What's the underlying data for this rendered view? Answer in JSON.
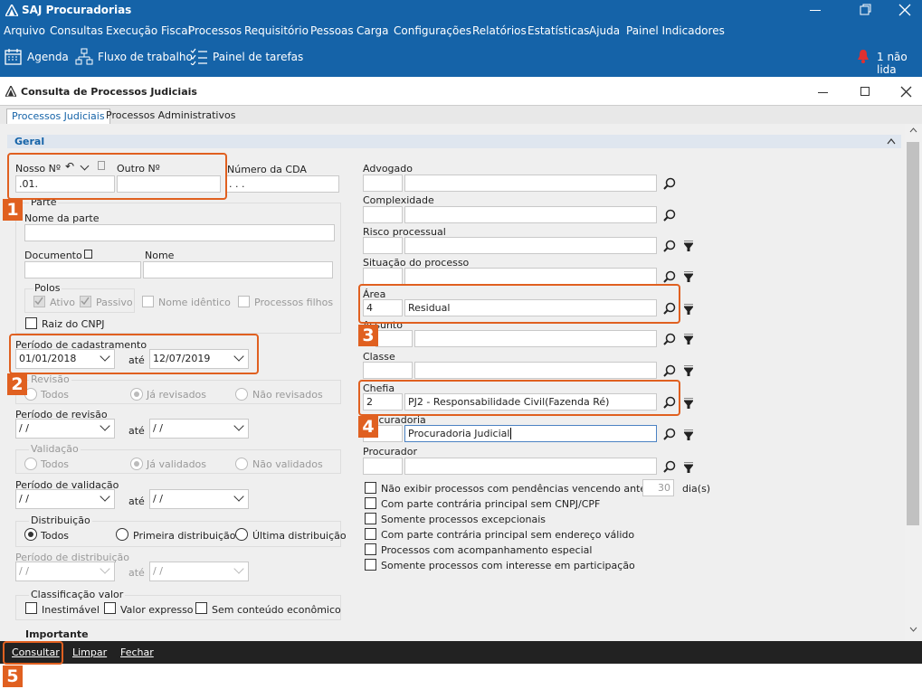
{
  "app": {
    "title": "SAJ Procuradorias"
  },
  "menu": [
    "Arquivo",
    "Consultas",
    "Execução Fiscal",
    "Processos",
    "Requisitório",
    "Pessoas",
    "Carga",
    "Configurações",
    "Relatórios",
    "Estatísticas",
    "Ajuda",
    "Painel Indicadores"
  ],
  "toolbar": {
    "agenda": "Agenda",
    "fluxo": "Fluxo de trabalho",
    "painel": "Painel de tarefas",
    "notif": "1 não lida"
  },
  "window": {
    "title": "Consulta de Processos Judiciais"
  },
  "tabs": [
    "Processos Judiciais",
    "Processos Administrativos"
  ],
  "section": {
    "title": "Geral"
  },
  "form": {
    "nosso_label": "Nosso Nº",
    "nosso_value": ".01.",
    "outro_label": "Outro Nº",
    "cda_label": "Número da CDA",
    "cda_value": ". . .",
    "parte_legend": "Parte",
    "nome_parte_label": "Nome da parte",
    "documento_label": "Documento",
    "nome_label": "Nome",
    "polos_legend": "Polos",
    "ativo": "Ativo",
    "passivo": "Passivo",
    "nome_identico": "Nome idêntico",
    "processos_filhos": "Processos filhos",
    "raiz_cnpj": "Raiz do CNPJ",
    "periodo_cad_label": "Período de cadastramento",
    "periodo_cad_ini": "01/01/2018",
    "ate": "até",
    "periodo_cad_fim": "12/07/2019",
    "revisao_legend": "Revisão",
    "todos": "Todos",
    "ja_revisados": "Já revisados",
    "nao_revisados": "Não revisados",
    "periodo_rev_label": "Período de revisão",
    "date_empty": "/ /",
    "validacao_legend": "Validação",
    "ja_validados": "Já validados",
    "nao_validados": "Não validados",
    "periodo_val_label": "Período de validação",
    "distribuicao_legend": "Distribuição",
    "primeira_dist": "Primeira distribuição",
    "ultima_dist": "Última distribuição",
    "periodo_dist_label": "Período de distribuição",
    "classificacao_legend": "Classificação valor",
    "inestimavel": "Inestimável",
    "valor_expresso": "Valor expresso",
    "sem_conteudo": "Sem conteúdo econômico",
    "importante_legend": "Importante",
    "advogado_label": "Advogado",
    "complexidade_label": "Complexidade",
    "risco_label": "Risco processual",
    "situacao_label": "Situação do processo",
    "area_label": "Área",
    "area_code": "4",
    "area_value": "Residual",
    "assunto_label": "Assunto",
    "classe_label": "Classe",
    "chefia_label": "Chefia",
    "chefia_code": "2",
    "chefia_value": "PJ2 - Responsabilidade Civil(Fazenda Ré)",
    "procuradoria_label": "Procuradoria",
    "procuradoria_value": "Procuradoria Judicial",
    "procurador_label": "Procurador",
    "opt_pendencias": "Não exibir processos com pendências vencendo antes de",
    "opt_pendencias_days": "30",
    "opt_dias": "dia(s)",
    "opt_cnpj": "Com parte contrária principal sem CNPJ/CPF",
    "opt_excepcionais": "Somente processos excepcionais",
    "opt_endereco": "Com parte contrária principal sem endereço válido",
    "opt_acompanhamento": "Processos com acompanhamento especial",
    "opt_interesse": "Somente processos com interesse em participação"
  },
  "buttons": {
    "consultar": "Consultar",
    "limpar": "Limpar",
    "fechar": "Fechar"
  },
  "callouts": [
    "1",
    "2",
    "3",
    "4",
    "5"
  ],
  "colors": {
    "header_blue": "#1563a8",
    "highlight_orange": "#e06020"
  }
}
